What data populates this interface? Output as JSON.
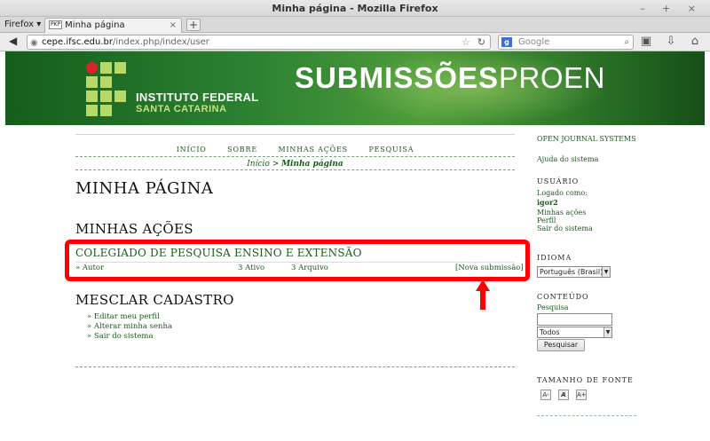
{
  "window": {
    "title": "Minha página - Mozilla Firefox",
    "controls": "– + ×",
    "firefox_menu": "Firefox ▾",
    "tab_favicon": "PKP",
    "tab_title": "Minha página",
    "new_tab": "+",
    "url_host": "cepe.ifsc.edu.br",
    "url_path": "/index.php/index/user",
    "search_placeholder": "Google"
  },
  "banner": {
    "institute_line1": "INSTITUTO FEDERAL",
    "institute_line2": "SANTA CATARINA",
    "title_bold": "SUBMISSÕES",
    "title_light": "PROEN"
  },
  "nav": {
    "items": [
      "INÍCIO",
      "SOBRE",
      "MINHAS AÇÕES",
      "PESQUISA"
    ]
  },
  "breadcrumb": {
    "home": "Início",
    "separator": " > ",
    "current": "Minha página"
  },
  "main": {
    "page_title": "MINHA PÁGINA",
    "actions_title": "MINHAS AÇÕES",
    "journal_title": "COLEGIADO DE PESQUISA ENSINO E EXTENSÃO",
    "role": "» Autor",
    "active": "3 Ativo",
    "archive": "3 Arquivo",
    "new_submission": "[Nova submissão]",
    "merge_title": "MESCLAR CADASTRO",
    "links": [
      "» Editar meu perfil",
      "» Alterar minha senha",
      "» Sair do sistema"
    ]
  },
  "sidebar": {
    "ojs": "OPEN JOURNAL SYSTEMS",
    "help": "Ajuda do sistema",
    "user_heading": "USUÁRIO",
    "logged_as": "Logado como:",
    "username": "igor2",
    "user_links": [
      "Minhas ações",
      "Perfil",
      "Sair do sistema"
    ],
    "language_heading": "IDIOMA",
    "language_value": "Português (Brasil)",
    "content_heading": "CONTEÚDO",
    "search_label": "Pesquisa",
    "search_scope": "Todos",
    "search_button": "Pesquisar",
    "font_heading": "TAMANHO DE FONTE",
    "font_buttons": [
      "A-",
      "A",
      "A+"
    ]
  },
  "annotation": {
    "highlight_color": "#ff0000"
  }
}
